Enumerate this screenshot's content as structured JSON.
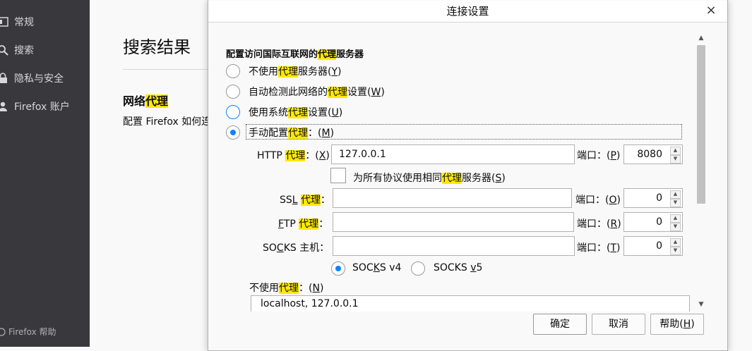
{
  "sidebar": {
    "items": [
      {
        "label": "常规"
      },
      {
        "label": "搜索"
      },
      {
        "label": "隐私与安全"
      },
      {
        "label": "Firefox 账户"
      }
    ],
    "footer": "Firefox 帮助"
  },
  "content": {
    "title": "搜索结果",
    "section_title_prefix": "网络",
    "section_title_hl": "代理",
    "section_desc": "配置 Firefox 如何连"
  },
  "dialog": {
    "title": "连接设置",
    "close": "×",
    "heading_prefix": "配置访问国际互联网的",
    "heading_hl": "代理",
    "heading_suffix": "服务器",
    "options": {
      "none": {
        "a": "不使用",
        "hl": "代理",
        "b": "服务器(",
        "key": "Y",
        "c": ")"
      },
      "auto": {
        "a": "自动检测此网络的",
        "hl": "代理",
        "b": "设置(",
        "key": "W",
        "c": ")"
      },
      "system": {
        "a": "使用系统",
        "hl": "代理",
        "b": "设置(",
        "key": "U",
        "c": ")"
      },
      "manual": {
        "a": "手动配置",
        "hl": "代理",
        "b": "：(",
        "key": "M",
        "c": ")"
      }
    },
    "http": {
      "a": "HTTP ",
      "hl": "代理",
      "b": "：(",
      "key": "X",
      "c": ")",
      "value": "127.0.0.1",
      "port_label_a": "端口：(",
      "port_key": "P",
      "port_label_c": ")",
      "port": "8080"
    },
    "share": {
      "a": "为所有协议使用相同",
      "hl": "代理",
      "b": "服务器(",
      "key": "S",
      "c": ")"
    },
    "ssl": {
      "a": "SS",
      "key": "L",
      "b": " ",
      "hl": "代理",
      "c": "：",
      "value": "",
      "port_label_a": "端口：(",
      "port_key": "O",
      "port_label_c": ")",
      "port": "0"
    },
    "ftp": {
      "key": "F",
      "a": "TP ",
      "hl": "代理",
      "c": "：",
      "value": "",
      "port_label_a": "端口：(",
      "port_key": "R",
      "port_label_c": ")",
      "port": "0"
    },
    "socks": {
      "a": "SO",
      "key": "C",
      "b": "KS 主机：",
      "value": "",
      "port_label_a": "端口：(",
      "port_key": "T",
      "port_label_c": ")",
      "port": "0"
    },
    "socks_v4": {
      "a": "SOC",
      "key": "K",
      "b": "S v4"
    },
    "socks_v5": {
      "a": "SOCKS ",
      "key": "v",
      "b": "5"
    },
    "no_proxy": {
      "a": "不使用",
      "hl": "代理",
      "b": "：(",
      "key": "N",
      "c": ")",
      "value": "localhost, 127.0.0.1"
    },
    "buttons": {
      "ok": "确定",
      "cancel": "取消",
      "help_a": "帮助(",
      "help_key": "H",
      "help_c": ")"
    }
  },
  "colors": {
    "highlight": "#ffe900",
    "accent": "#0a84ff",
    "sidebar_bg": "#38383d"
  },
  "icons": [
    "general-icon",
    "search-icon",
    "lock-icon",
    "account-icon",
    "help-icon",
    "close-icon"
  ]
}
